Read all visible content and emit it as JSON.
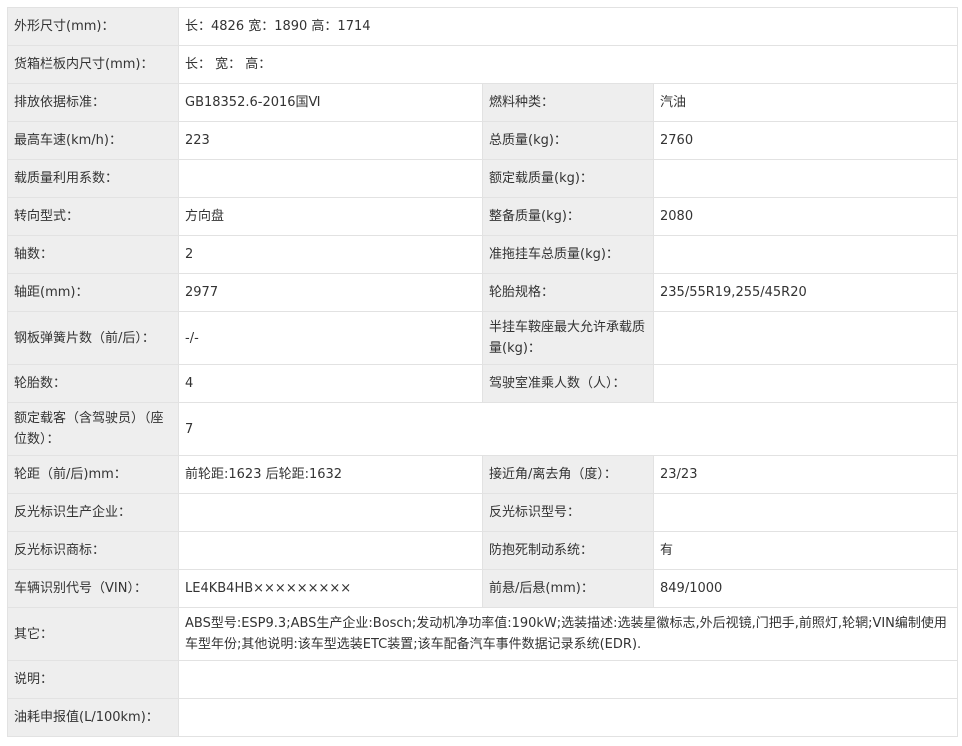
{
  "rows": [
    {
      "type": "wide",
      "h": "h38",
      "label": "外形尺寸(mm)：",
      "value": "长：4826 宽：1890 高：1714"
    },
    {
      "type": "wide",
      "h": "h38",
      "label": "货箱栏板内尺寸(mm)：",
      "value": "长：  宽：  高："
    },
    {
      "type": "pair",
      "h": "h38",
      "label1": "排放依据标准：",
      "value1": "GB18352.6-2016国Ⅵ",
      "label2": "燃料种类：",
      "value2": "汽油"
    },
    {
      "type": "pair",
      "h": "h38",
      "label1": "最高车速(km/h)：",
      "value1": "223",
      "label2": "总质量(kg)：",
      "value2": "2760"
    },
    {
      "type": "pair",
      "h": "h38",
      "label1": "载质量利用系数：",
      "value1": "",
      "label2": "额定载质量(kg)：",
      "value2": ""
    },
    {
      "type": "pair",
      "h": "h38",
      "label1": "转向型式：",
      "value1": "方向盘",
      "label2": "整备质量(kg)：",
      "value2": "2080"
    },
    {
      "type": "pair",
      "h": "h38",
      "label1": "轴数：",
      "value1": "2",
      "label2": "准拖挂车总质量(kg)：",
      "value2": ""
    },
    {
      "type": "pair",
      "h": "h38",
      "label1": "轴距(mm)：",
      "value1": "2977",
      "label2": "轮胎规格：",
      "value2": "235/55R19,255/45R20"
    },
    {
      "type": "pair",
      "h": "h53",
      "label1": "钢板弹簧片数（前/后）：",
      "value1": "-/-",
      "label2": "半挂车鞍座最大允许承载质量(kg)：",
      "value2": ""
    },
    {
      "type": "pair",
      "h": "h38",
      "label1": "轮胎数：",
      "value1": "4",
      "label2": "驾驶室准乘人数（人）：",
      "value2": ""
    },
    {
      "type": "wide",
      "h": "h53",
      "label": "额定载客（含驾驶员）（座位数）：",
      "value": "7"
    },
    {
      "type": "pair",
      "h": "h38",
      "label1": "轮距（前/后)mm：",
      "value1": "前轮距:1623 后轮距:1632",
      "label2": "接近角/离去角（度）：",
      "value2": "23/23"
    },
    {
      "type": "pair",
      "h": "h38",
      "label1": "反光标识生产企业：",
      "value1": "",
      "label2": "反光标识型号：",
      "value2": ""
    },
    {
      "type": "pair",
      "h": "h38",
      "label1": "反光标识商标：",
      "value1": "",
      "label2": "防抱死制动系统：",
      "value2": "有"
    },
    {
      "type": "pair",
      "h": "h38",
      "label1": "车辆识别代号（VIN）：",
      "value1": "LE4KB4HB×××××××××",
      "label2": "前悬/后悬(mm)：",
      "value2": "849/1000"
    },
    {
      "type": "wide",
      "h": "h53",
      "label": "其它：",
      "value": "ABS型号:ESP9.3;ABS生产企业:Bosch;发动机净功率值:190kW;选装描述:选装星徽标志,外后视镜,门把手,前照灯,轮辋;VIN编制使用车型年份;其他说明:该车型选装ETC装置;该车配备汽车事件数据记录系统(EDR)."
    },
    {
      "type": "wide",
      "h": "h38",
      "label": "说明：",
      "value": ""
    },
    {
      "type": "wide",
      "h": "h38",
      "label": "油耗申报值(L/100km)：",
      "value": ""
    }
  ]
}
